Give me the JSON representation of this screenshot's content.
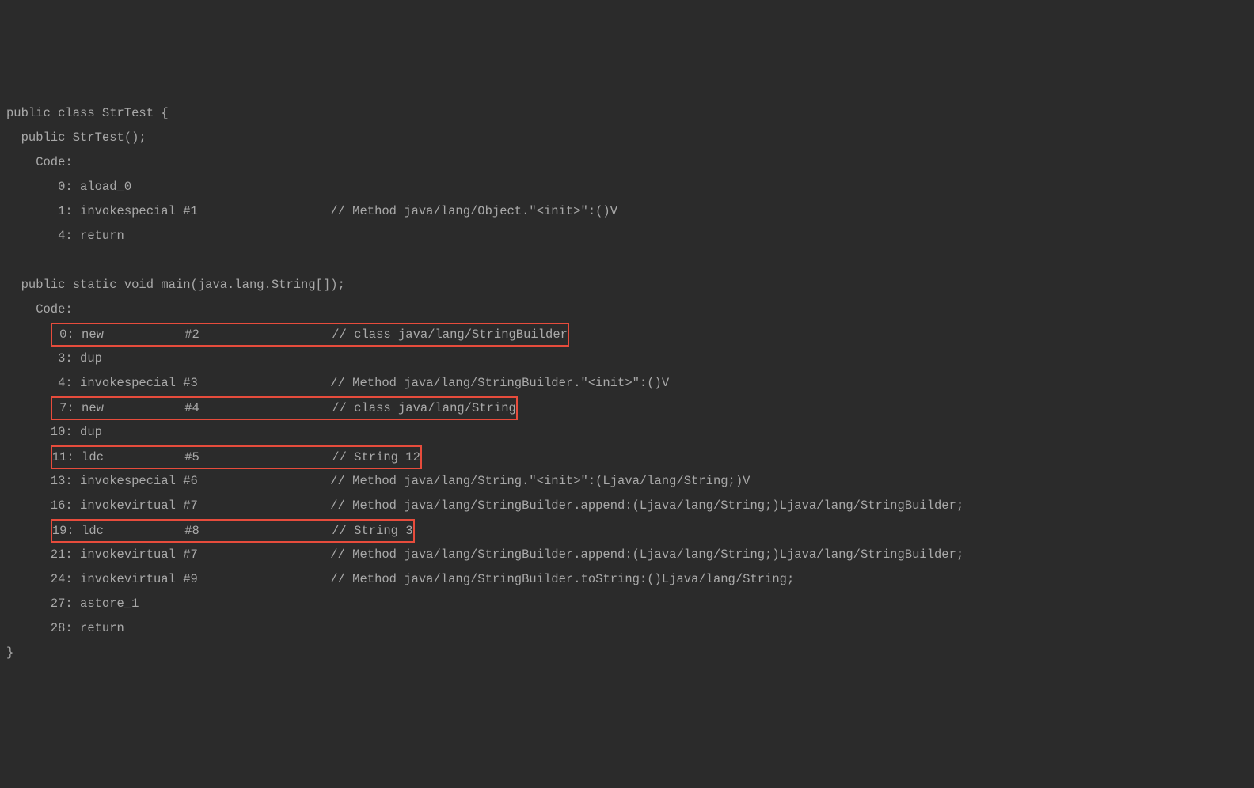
{
  "lines": [
    {
      "text": "public class StrTest {",
      "highlight": false
    },
    {
      "text": "  public StrTest();",
      "highlight": false
    },
    {
      "text": "    Code:",
      "highlight": false
    },
    {
      "text": "       0: aload_0",
      "highlight": false
    },
    {
      "text": "       1: invokespecial #1                  // Method java/lang/Object.\"<init>\":()V",
      "highlight": false
    },
    {
      "text": "       4: return",
      "highlight": false
    },
    {
      "text": "",
      "highlight": false
    },
    {
      "text": "  public static void main(java.lang.String[]);",
      "highlight": false
    },
    {
      "text": "    Code:",
      "highlight": false
    },
    {
      "text": "      ",
      "boxed": " 0: new           #2                  // class java/lang/StringBuilder",
      "highlight": true
    },
    {
      "text": "       3: dup",
      "highlight": false
    },
    {
      "text": "       4: invokespecial #3                  // Method java/lang/StringBuilder.\"<init>\":()V",
      "highlight": false
    },
    {
      "text": "      ",
      "boxed": " 7: new           #4                  // class java/lang/String",
      "highlight": true
    },
    {
      "text": "      10: dup",
      "highlight": false
    },
    {
      "text": "      ",
      "boxed": "11: ldc           #5                  // String 12",
      "highlight": true
    },
    {
      "text": "      13: invokespecial #6                  // Method java/lang/String.\"<init>\":(Ljava/lang/String;)V",
      "highlight": false
    },
    {
      "text": "      16: invokevirtual #7                  // Method java/lang/StringBuilder.append:(Ljava/lang/String;)Ljava/lang/StringBuilder;",
      "highlight": false
    },
    {
      "text": "      ",
      "boxed": "19: ldc           #8                  // String 3",
      "highlight": true
    },
    {
      "text": "      21: invokevirtual #7                  // Method java/lang/StringBuilder.append:(Ljava/lang/String;)Ljava/lang/StringBuilder;",
      "highlight": false
    },
    {
      "text": "      24: invokevirtual #9                  // Method java/lang/StringBuilder.toString:()Ljava/lang/String;",
      "highlight": false
    },
    {
      "text": "      27: astore_1",
      "highlight": false
    },
    {
      "text": "      28: return",
      "highlight": false
    },
    {
      "text": "}",
      "highlight": false
    }
  ]
}
